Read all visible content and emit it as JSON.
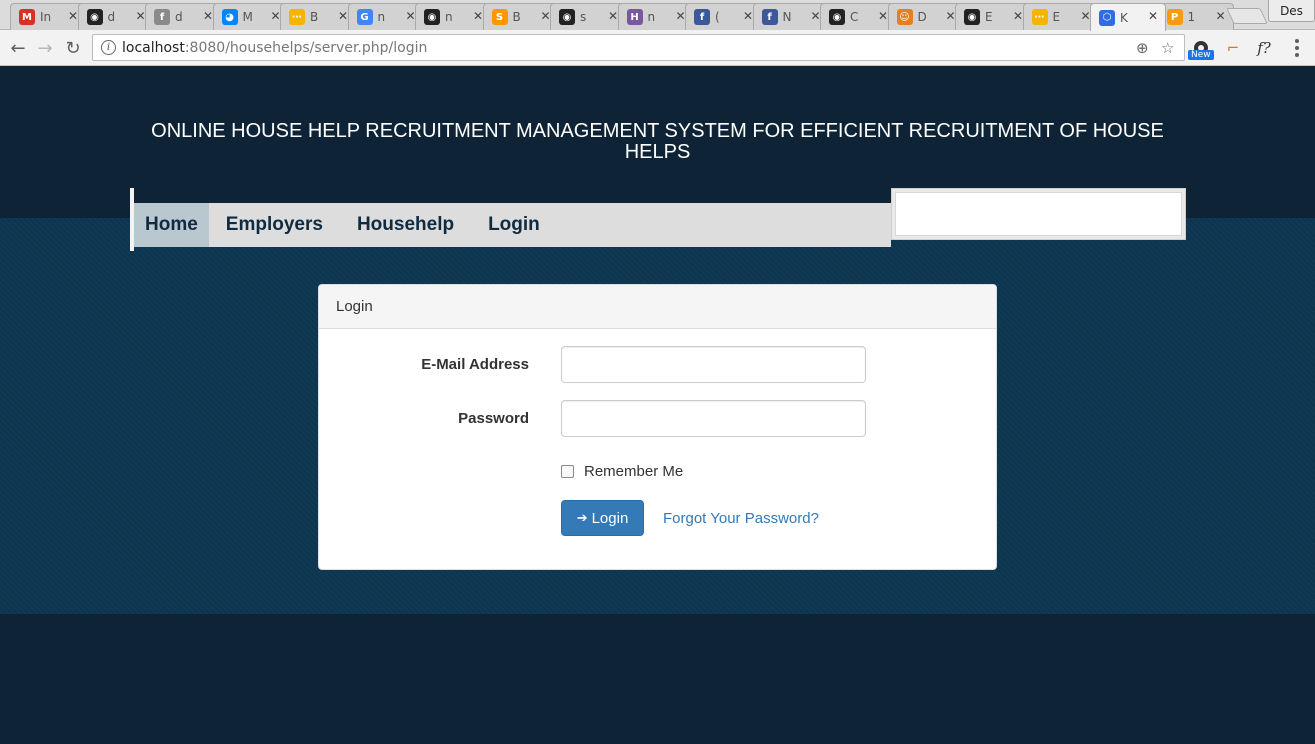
{
  "browser": {
    "tabs": [
      {
        "title": "In",
        "favicon": "gmail-icon",
        "color": "#d93025",
        "glyph": "M"
      },
      {
        "title": "d",
        "favicon": "github-icon",
        "color": "#222222",
        "glyph": "◉"
      },
      {
        "title": "d",
        "favicon": "facebook-icon",
        "color": "#8a8a8a",
        "glyph": "f"
      },
      {
        "title": "M",
        "favicon": "messenger-icon",
        "color": "#0084ff",
        "glyph": "◕"
      },
      {
        "title": "B",
        "favicon": "bookmark-icon",
        "color": "#f4b400",
        "glyph": "⋯"
      },
      {
        "title": "n",
        "favicon": "google-icon",
        "color": "#4285f4",
        "glyph": "G"
      },
      {
        "title": "n",
        "favicon": "github-icon",
        "color": "#222222",
        "glyph": "◉"
      },
      {
        "title": "B",
        "favicon": "sublime-icon",
        "color": "#ff9800",
        "glyph": "S"
      },
      {
        "title": "s",
        "favicon": "github-icon",
        "color": "#222222",
        "glyph": "◉"
      },
      {
        "title": "n",
        "favicon": "heroku-icon",
        "color": "#79589f",
        "glyph": "H"
      },
      {
        "title": "(",
        "favicon": "facebook-icon",
        "color": "#3b5998",
        "glyph": "f"
      },
      {
        "title": "N",
        "favicon": "facebook-icon",
        "color": "#3b5998",
        "glyph": "f"
      },
      {
        "title": "C",
        "favicon": "github-icon",
        "color": "#222222",
        "glyph": "◉"
      },
      {
        "title": "D",
        "favicon": "ubuntu-icon",
        "color": "#e67e22",
        "glyph": "☺"
      },
      {
        "title": "E",
        "favicon": "github-icon",
        "color": "#222222",
        "glyph": "◉"
      },
      {
        "title": "E",
        "favicon": "bookmark-icon",
        "color": "#f4b400",
        "glyph": "⋯"
      },
      {
        "title": "K",
        "favicon": "kubernetes-icon",
        "color": "#326ce5",
        "glyph": "⬡"
      },
      {
        "title": "1",
        "favicon": "phpmyadmin-icon",
        "color": "#f89c0e",
        "glyph": "P"
      }
    ],
    "active_tab_index": 16,
    "profile_label": "Des",
    "url_host": "localhost",
    "url_rest": ":8080/househelps/server.php/login",
    "new_badge": "New",
    "ext_f": "f?"
  },
  "site": {
    "title": "ONLINE HOUSE HELP RECRUITMENT MANAGEMENT SYSTEM FOR EFFICIENT RECRUITMENT OF HOUSE HELPS",
    "nav": [
      {
        "label": "Home",
        "active": true
      },
      {
        "label": "Employers",
        "active": false
      },
      {
        "label": "Househelp",
        "active": false
      },
      {
        "label": "Login",
        "active": false
      }
    ]
  },
  "login": {
    "heading": "Login",
    "email_label": "E-Mail Address",
    "email_value": "",
    "password_label": "Password",
    "password_value": "",
    "remember_label": "Remember Me",
    "remember_checked": false,
    "submit_label": "Login",
    "forgot_label": "Forgot Your Password?"
  },
  "colors": {
    "header_bg": "#0e2436",
    "band_bg": "#0f3853",
    "primary": "#337ab7"
  }
}
